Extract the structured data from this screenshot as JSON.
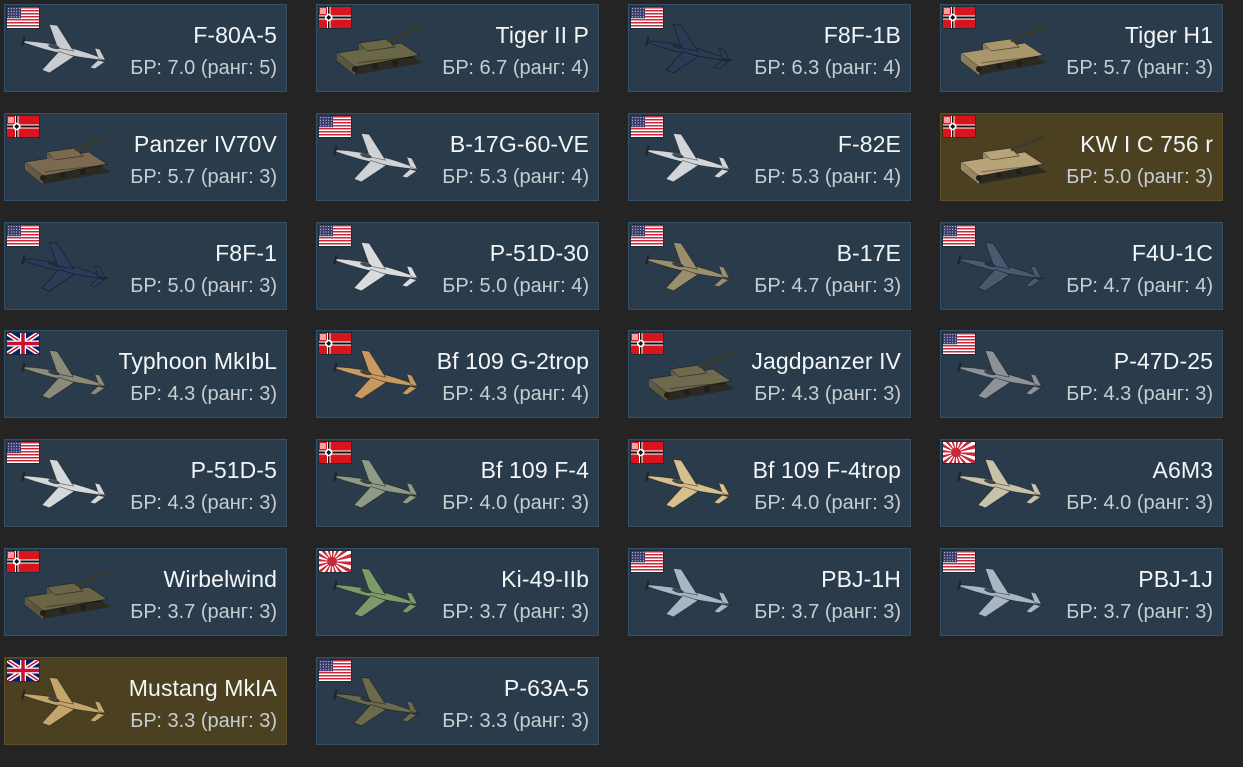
{
  "br_prefix": "БР:",
  "rank_prefix": "ранг:",
  "vehicles": [
    {
      "name": "F-80A-5",
      "br": "7.0",
      "rank": "5",
      "nation": "usa",
      "type": "plane",
      "premium": false,
      "color": "#c9cdd2"
    },
    {
      "name": "Tiger II P",
      "br": "6.7",
      "rank": "4",
      "nation": "germany",
      "type": "tank",
      "premium": false,
      "color": "#6a6648"
    },
    {
      "name": "F8F-1B",
      "br": "6.3",
      "rank": "4",
      "nation": "usa",
      "type": "plane",
      "premium": false,
      "color": "#2c3a55"
    },
    {
      "name": "Tiger H1",
      "br": "5.7",
      "rank": "3",
      "nation": "germany",
      "type": "tank",
      "premium": false,
      "color": "#a9966b"
    },
    {
      "name": "Panzer IV70V",
      "br": "5.7",
      "rank": "3",
      "nation": "germany",
      "type": "tank",
      "premium": false,
      "color": "#7b6a4f"
    },
    {
      "name": "B-17G-60-VE",
      "br": "5.3",
      "rank": "4",
      "nation": "usa",
      "type": "plane",
      "premium": false,
      "color": "#cfd3d8"
    },
    {
      "name": "F-82E",
      "br": "5.3",
      "rank": "4",
      "nation": "usa",
      "type": "plane",
      "premium": false,
      "color": "#d2d6db"
    },
    {
      "name": "KW I C 756 r",
      "br": "5.0",
      "rank": "3",
      "nation": "germany",
      "type": "tank",
      "premium": true,
      "color": "#b8a47a"
    },
    {
      "name": "F8F-1",
      "br": "5.0",
      "rank": "3",
      "nation": "usa",
      "type": "plane",
      "premium": false,
      "color": "#2d3b58"
    },
    {
      "name": "P-51D-30",
      "br": "5.0",
      "rank": "4",
      "nation": "usa",
      "type": "plane",
      "premium": false,
      "color": "#d9dcdf"
    },
    {
      "name": "B-17E",
      "br": "4.7",
      "rank": "3",
      "nation": "usa",
      "type": "plane",
      "premium": false,
      "color": "#9b8e6c"
    },
    {
      "name": "F4U-1C",
      "br": "4.7",
      "rank": "4",
      "nation": "usa",
      "type": "plane",
      "premium": false,
      "color": "#4a5870"
    },
    {
      "name": "Typhoon MkIbL",
      "br": "4.3",
      "rank": "3",
      "nation": "uk",
      "type": "plane",
      "premium": false,
      "color": "#8a8b7a"
    },
    {
      "name": "Bf 109 G-2trop",
      "br": "4.3",
      "rank": "4",
      "nation": "germany",
      "type": "plane",
      "premium": false,
      "color": "#c79a62"
    },
    {
      "name": "Jagdpanzer IV",
      "br": "4.3",
      "rank": "3",
      "nation": "germany",
      "type": "tank",
      "premium": false,
      "color": "#6e6a4e"
    },
    {
      "name": "P-47D-25",
      "br": "4.3",
      "rank": "3",
      "nation": "usa",
      "type": "plane",
      "premium": false,
      "color": "#8c9298"
    },
    {
      "name": "P-51D-5",
      "br": "4.3",
      "rank": "3",
      "nation": "usa",
      "type": "plane",
      "premium": false,
      "color": "#d6d9dc"
    },
    {
      "name": "Bf 109 F-4",
      "br": "4.0",
      "rank": "3",
      "nation": "germany",
      "type": "plane",
      "premium": false,
      "color": "#8f9a86"
    },
    {
      "name": "Bf 109 F-4trop",
      "br": "4.0",
      "rank": "3",
      "nation": "germany",
      "type": "plane",
      "premium": false,
      "color": "#d8c08d"
    },
    {
      "name": "A6M3",
      "br": "4.0",
      "rank": "3",
      "nation": "japan",
      "type": "plane",
      "premium": false,
      "color": "#c9c2aa"
    },
    {
      "name": "Wirbelwind",
      "br": "3.7",
      "rank": "3",
      "nation": "germany",
      "type": "tank",
      "premium": false,
      "color": "#6b6547"
    },
    {
      "name": "Ki-49-IIb",
      "br": "3.7",
      "rank": "3",
      "nation": "japan",
      "type": "plane",
      "premium": false,
      "color": "#7d9a6a"
    },
    {
      "name": "PBJ-1H",
      "br": "3.7",
      "rank": "3",
      "nation": "usa",
      "type": "plane",
      "premium": false,
      "color": "#a8b6c6"
    },
    {
      "name": "PBJ-1J",
      "br": "3.7",
      "rank": "3",
      "nation": "usa",
      "type": "plane",
      "premium": false,
      "color": "#a8b6c6"
    },
    {
      "name": "Mustang MkIA",
      "br": "3.3",
      "rank": "3",
      "nation": "uk",
      "type": "plane",
      "premium": true,
      "color": "#c4a56b"
    },
    {
      "name": "P-63A-5",
      "br": "3.3",
      "rank": "3",
      "nation": "usa",
      "type": "plane",
      "premium": false,
      "color": "#6b6a4d"
    }
  ]
}
